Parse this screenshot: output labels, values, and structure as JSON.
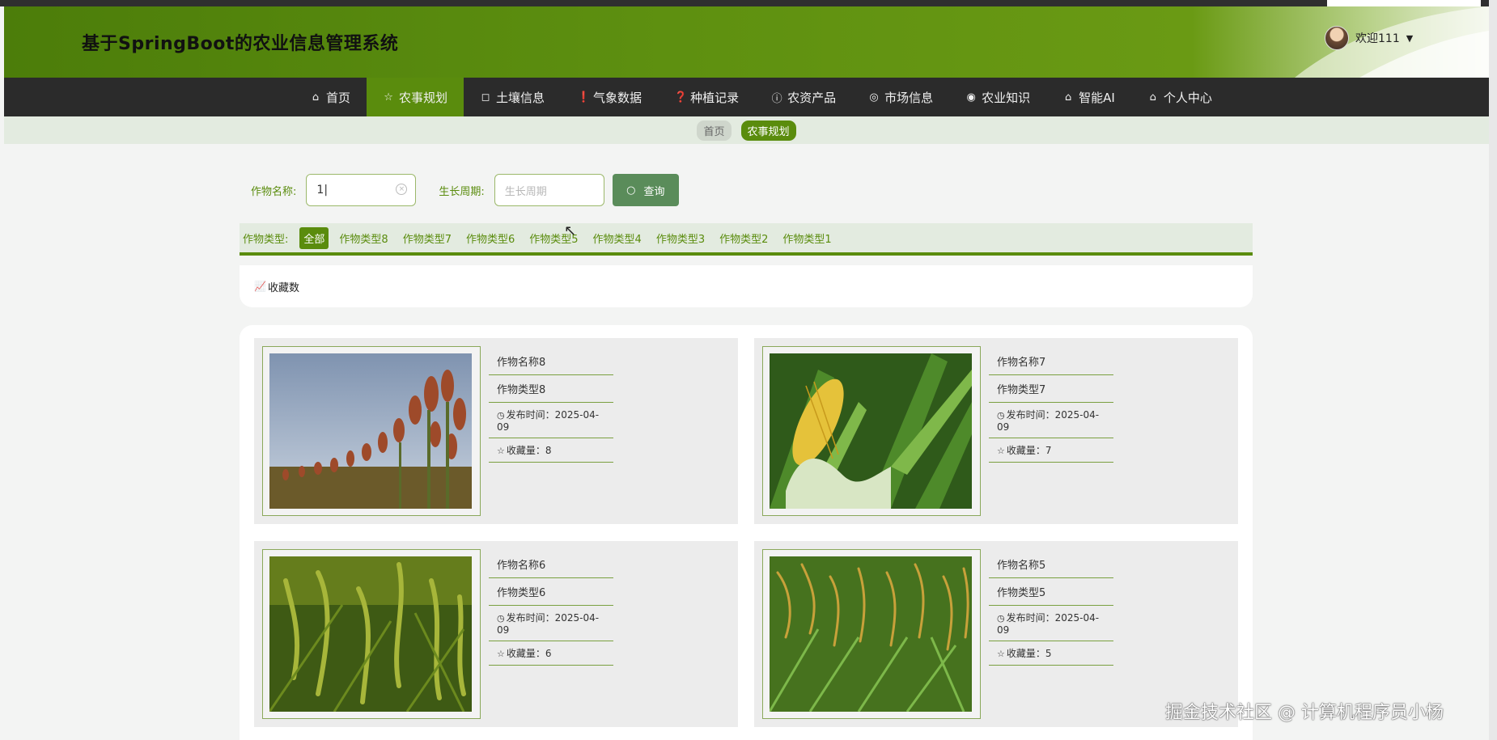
{
  "header": {
    "title": "基于SpringBoot的农业信息管理系统",
    "welcome": "欢迎111"
  },
  "nav": [
    {
      "label": "首页",
      "icon": "⌂"
    },
    {
      "label": "农事规划",
      "icon": "☆"
    },
    {
      "label": "土壤信息",
      "icon": "◻"
    },
    {
      "label": "气象数据",
      "icon": "❗"
    },
    {
      "label": "种植记录",
      "icon": "❓"
    },
    {
      "label": "农资产品",
      "icon": "ⓘ"
    },
    {
      "label": "市场信息",
      "icon": "◎"
    },
    {
      "label": "农业知识",
      "icon": "◉"
    },
    {
      "label": "智能AI",
      "icon": "⌂"
    },
    {
      "label": "个人中心",
      "icon": "⌂"
    }
  ],
  "breadcrumb": {
    "home": "首页",
    "current": "农事规划"
  },
  "search": {
    "name_label": "作物名称:",
    "name_value": "1",
    "cycle_label": "生长周期:",
    "cycle_placeholder": "生长周期",
    "button": "查询"
  },
  "types": {
    "label": "作物类型:",
    "items": [
      "全部",
      "作物类型8",
      "作物类型7",
      "作物类型6",
      "作物类型5",
      "作物类型4",
      "作物类型3",
      "作物类型2",
      "作物类型1"
    ]
  },
  "sort": {
    "label": "收藏数"
  },
  "cards": [
    {
      "name": "作物名称8",
      "type": "作物类型8",
      "date": "发布时间：2025-04-09",
      "fav": "收藏量：8"
    },
    {
      "name": "作物名称7",
      "type": "作物类型7",
      "date": "发布时间：2025-04-09",
      "fav": "收藏量：7"
    },
    {
      "name": "作物名称6",
      "type": "作物类型6",
      "date": "发布时间：2025-04-09",
      "fav": "收藏量：6"
    },
    {
      "name": "作物名称5",
      "type": "作物类型5",
      "date": "发布时间：2025-04-09",
      "fav": "收藏量：5"
    }
  ],
  "watermark": "掘金技术社区 @ 计算机程序员小杨"
}
